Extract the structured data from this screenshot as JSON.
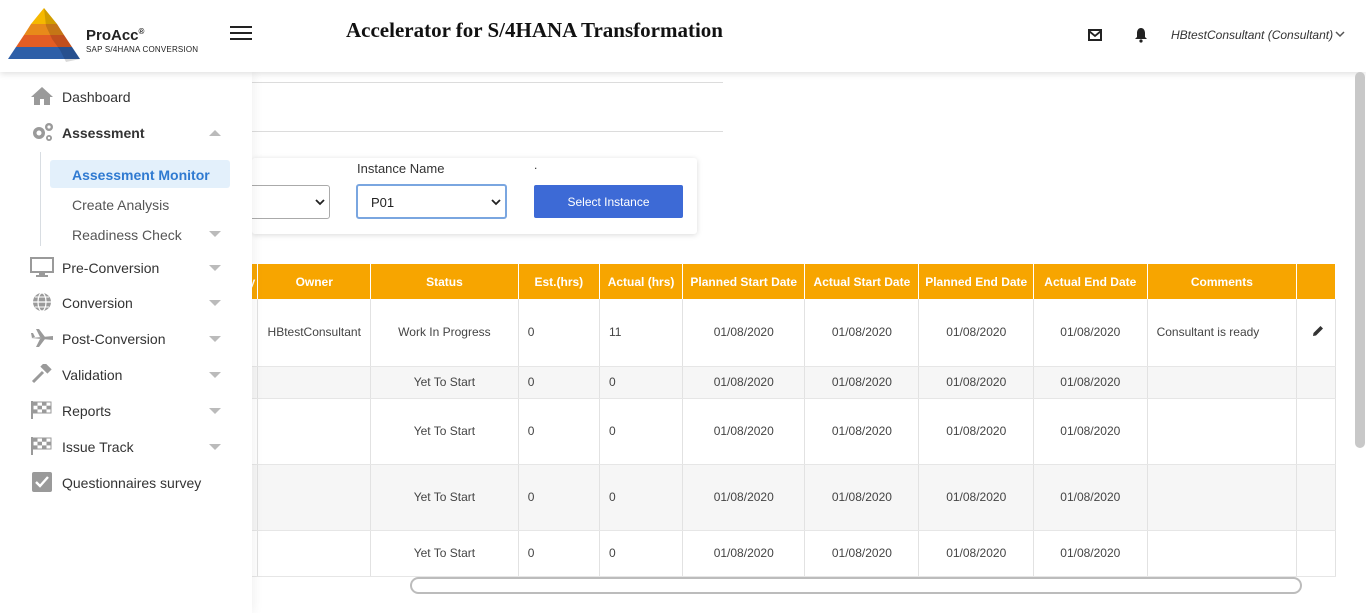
{
  "header": {
    "logo_title": "ProAcc",
    "logo_reg": "®",
    "logo_subtitle": "SAP S/4HANA CONVERSION",
    "app_title": "Accelerator for S/4HANA Transformation",
    "user_label": "HBtestConsultant (Consultant)"
  },
  "sidebar": {
    "dashboard": "Dashboard",
    "assessment": "Assessment",
    "assessment_monitor": "Assessment Monitor",
    "create_analysis": "Create Analysis",
    "readiness_check": "Readiness Check",
    "pre_conversion": "Pre-Conversion",
    "conversion": "Conversion",
    "post_conversion": "Post-Conversion",
    "validation": "Validation",
    "reports": "Reports",
    "issue_track": "Issue Track",
    "questionnaires": "Questionnaires survey"
  },
  "instance": {
    "label": "Instance Name",
    "dot": ".",
    "selected": "P01",
    "button": "Select Instance"
  },
  "table": {
    "headers": [
      "y",
      "Owner",
      "Status",
      "Est.(hrs)",
      "Actual (hrs)",
      "Planned Start Date",
      "Actual Start Date",
      "Planned End Date",
      "Actual End Date",
      "Comments",
      ""
    ],
    "rows": [
      {
        "owner": "HBtestConsultant",
        "status": "Work In Progress",
        "est": "0",
        "actual": "11",
        "ps": "01/08/2020",
        "as": "01/08/2020",
        "pe": "01/08/2020",
        "ae": "01/08/2020",
        "comments": "Consultant is ready"
      },
      {
        "owner": "",
        "status": "Yet To Start",
        "est": "0",
        "actual": "0",
        "ps": "01/08/2020",
        "as": "01/08/2020",
        "pe": "01/08/2020",
        "ae": "01/08/2020",
        "comments": ""
      },
      {
        "owner": "",
        "status": "Yet To Start",
        "est": "0",
        "actual": "0",
        "ps": "01/08/2020",
        "as": "01/08/2020",
        "pe": "01/08/2020",
        "ae": "01/08/2020",
        "comments": ""
      },
      {
        "owner": "",
        "status": "Yet To Start",
        "est": "0",
        "actual": "0",
        "ps": "01/08/2020",
        "as": "01/08/2020",
        "pe": "01/08/2020",
        "ae": "01/08/2020",
        "comments": ""
      },
      {
        "owner": "",
        "status": "Yet To Start",
        "est": "0",
        "actual": "0",
        "ps": "01/08/2020",
        "as": "01/08/2020",
        "pe": "01/08/2020",
        "ae": "01/08/2020",
        "comments": ""
      }
    ]
  },
  "colors": {
    "accent": "#3d6ad6",
    "table_header": "#f7a500",
    "active_nav_bg": "#e3f0fb",
    "active_nav_text": "#2f7ad1"
  },
  "icons": {
    "menu": "hamburger-icon",
    "mail": "mail-icon",
    "notifications": "bell-icon",
    "edit": "pencil-icon"
  }
}
